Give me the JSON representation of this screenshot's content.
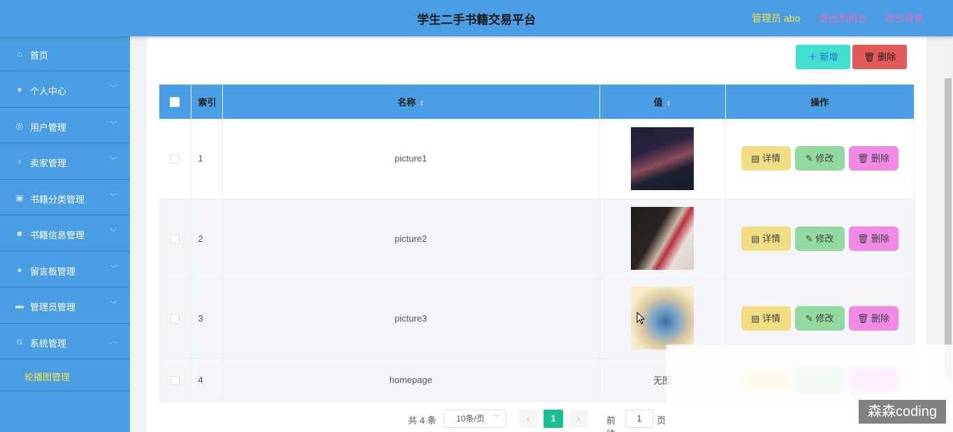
{
  "header": {
    "title": "学生二手书籍交易平台",
    "admin_label": "管理员 abo",
    "back_link": "退出到前台",
    "logout_link": "退出登录"
  },
  "sidebar": {
    "items": [
      {
        "label": "首页",
        "icon": "home-icon"
      },
      {
        "label": "个人中心",
        "icon": "user-icon"
      },
      {
        "label": "用户管理",
        "icon": "compass-icon"
      },
      {
        "label": "卖家管理",
        "icon": "microphone-icon"
      },
      {
        "label": "书籍分类管理",
        "icon": "clipboard-icon"
      },
      {
        "label": "书籍信息管理",
        "icon": "book-icon"
      },
      {
        "label": "留言板管理",
        "icon": "user-icon"
      },
      {
        "label": "管理员管理",
        "icon": "ticket-icon"
      },
      {
        "label": "系统管理",
        "icon": "bell-off-icon"
      }
    ],
    "submenu_label": "轮播图管理"
  },
  "toolbar": {
    "add_label": "新增",
    "delete_label": "删除"
  },
  "table": {
    "headers": {
      "index": "索引",
      "name": "名称",
      "value": "值",
      "actions": "操作"
    },
    "rows": [
      {
        "index": "1",
        "name": "picture1",
        "value": "image"
      },
      {
        "index": "2",
        "name": "picture2",
        "value": "image"
      },
      {
        "index": "3",
        "name": "picture3",
        "value": "image"
      },
      {
        "index": "4",
        "name": "homepage",
        "value": "无图"
      }
    ],
    "actions": {
      "detail": "详情",
      "edit": "修改",
      "delete": "删除"
    }
  },
  "pagination": {
    "total": "共 4 条",
    "page_size": "10条/页",
    "current_page": "1",
    "goto_label": "前往",
    "goto_value": "1",
    "page_suffix": "页"
  },
  "watermark": "森森coding",
  "colors": {
    "primary": "#4a9ee3",
    "admin_text": "#f3e04a",
    "link_text": "#e46ec8",
    "add_button": "#40e0d0",
    "delete_button": "#e45959",
    "detail_button": "#f0dd84",
    "edit_button": "#92d9a0",
    "row_delete_button": "#f08ae6",
    "current_page": "#17c08e"
  }
}
